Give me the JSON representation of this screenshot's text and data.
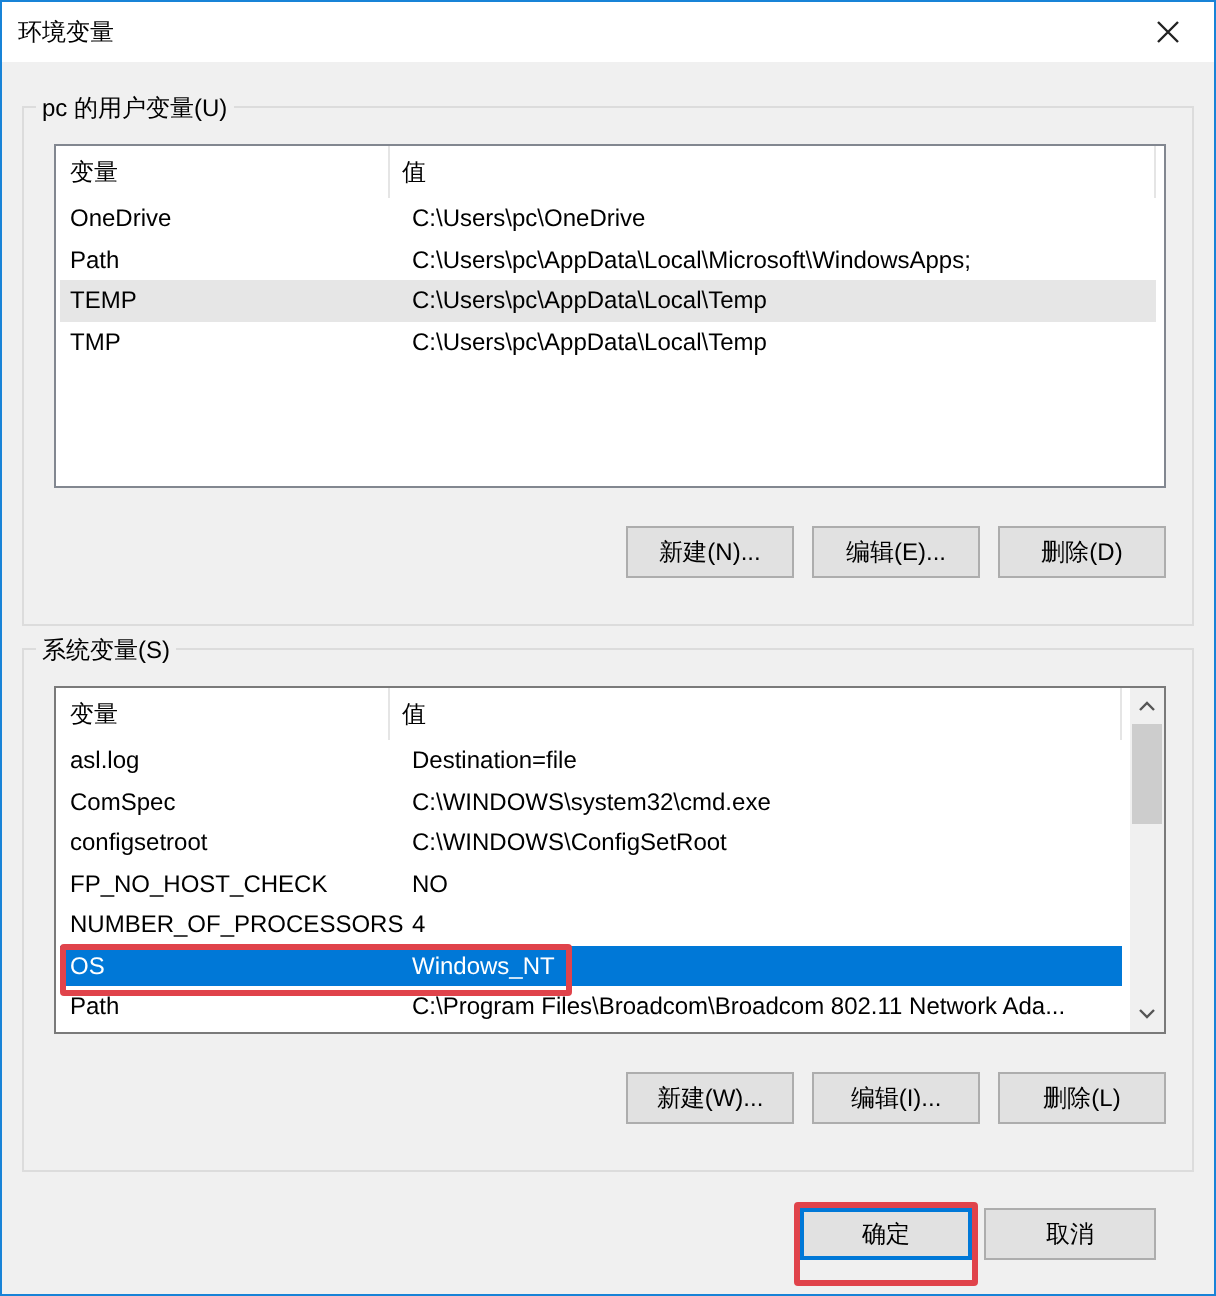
{
  "window": {
    "title": "环境变量"
  },
  "user_group": {
    "label": "pc 的用户变量(U)",
    "list": {
      "focused": false,
      "columns": [
        "变量",
        "值"
      ],
      "scrollbar": false,
      "rows": [
        {
          "name": "OneDrive",
          "value": "C:\\Users\\pc\\OneDrive",
          "selected": false,
          "highlighted": false
        },
        {
          "name": "Path",
          "value": "C:\\Users\\pc\\AppData\\Local\\Microsoft\\WindowsApps;",
          "selected": false,
          "highlighted": false
        },
        {
          "name": "TEMP",
          "value": "C:\\Users\\pc\\AppData\\Local\\Temp",
          "selected": true,
          "highlighted": false
        },
        {
          "name": "TMP",
          "value": "C:\\Users\\pc\\AppData\\Local\\Temp",
          "selected": false,
          "highlighted": false
        }
      ]
    },
    "buttons": [
      "新建(N)...",
      "编辑(E)...",
      "删除(D)"
    ]
  },
  "system_group": {
    "label": "系统变量(S)",
    "list": {
      "focused": true,
      "columns": [
        "变量",
        "值"
      ],
      "scrollbar": true,
      "rows": [
        {
          "name": "asl.log",
          "value": "Destination=file",
          "selected": false,
          "highlighted": false
        },
        {
          "name": "ComSpec",
          "value": "C:\\WINDOWS\\system32\\cmd.exe",
          "selected": false,
          "highlighted": false
        },
        {
          "name": "configsetroot",
          "value": "C:\\WINDOWS\\ConfigSetRoot",
          "selected": false,
          "highlighted": false
        },
        {
          "name": "FP_NO_HOST_CHECK",
          "value": "NO",
          "selected": false,
          "highlighted": false
        },
        {
          "name": "NUMBER_OF_PROCESSORS",
          "value": "4",
          "selected": false,
          "highlighted": false
        },
        {
          "name": "OS",
          "value": "Windows_NT",
          "selected": true,
          "highlighted": true
        },
        {
          "name": "Path",
          "value": "C:\\Program Files\\Broadcom\\Broadcom 802.11 Network Ada...",
          "selected": false,
          "highlighted": false
        }
      ]
    },
    "buttons": [
      "新建(W)...",
      "编辑(I)...",
      "删除(L)"
    ]
  },
  "footer_buttons": [
    {
      "label": "确定",
      "default": true,
      "highlighted": true
    },
    {
      "label": "取消",
      "default": false,
      "highlighted": false
    }
  ]
}
